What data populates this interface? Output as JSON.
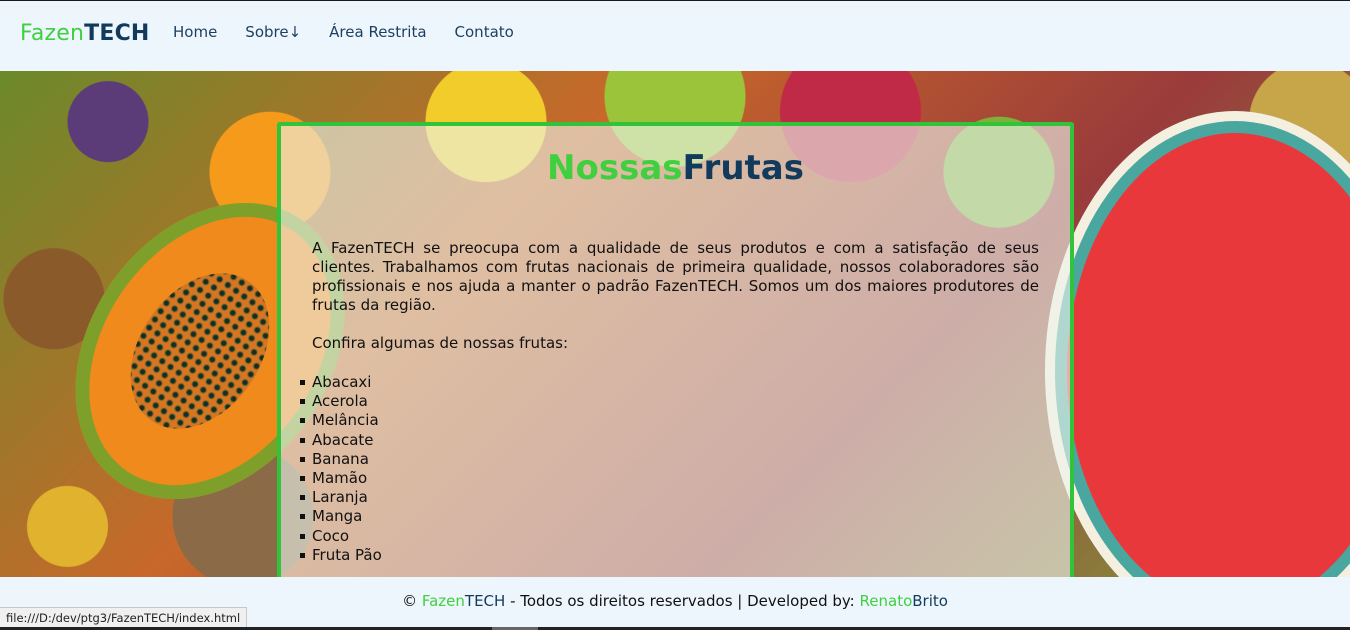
{
  "header": {
    "logo_part1": "Fazen",
    "logo_part2": "TECH",
    "nav": [
      {
        "label": "Home"
      },
      {
        "label": "Sobre↓"
      },
      {
        "label": "Área Restrita"
      },
      {
        "label": "Contato"
      }
    ]
  },
  "main": {
    "title_part1": "Nossas",
    "title_part2": "Frutas",
    "paragraph": "A FazenTECH se preocupa com a qualidade de seus produtos e com a satisfação de seus clientes. Trabalhamos com frutas nacionais de primeira qualidade, nossos colaboradores são profissionais e nos ajuda a manter o padrão FazenTECH. Somos um dos maiores produtores de frutas da região.",
    "list_intro": "Confira algumas de nossas frutas:",
    "fruits": [
      "Abacaxi",
      "Acerola",
      "Melância",
      "Abacate",
      "Banana",
      "Mamão",
      "Laranja",
      "Manga",
      "Coco",
      "Fruta Pão"
    ]
  },
  "footer": {
    "copyright_symbol": "©",
    "brand_part1": "Fazen",
    "brand_part2": "TECH",
    "rights_text": " - Todos os direitos reservados | Developed by: ",
    "dev_part1": "Renato",
    "dev_part2": "Brito"
  },
  "status_bar": {
    "url": "file:///D:/dev/ptg3/FazenTECH/index.html"
  },
  "colors": {
    "brand_green": "#3fcf3f",
    "brand_navy": "#123a5c",
    "panel_border": "#31c43a"
  }
}
